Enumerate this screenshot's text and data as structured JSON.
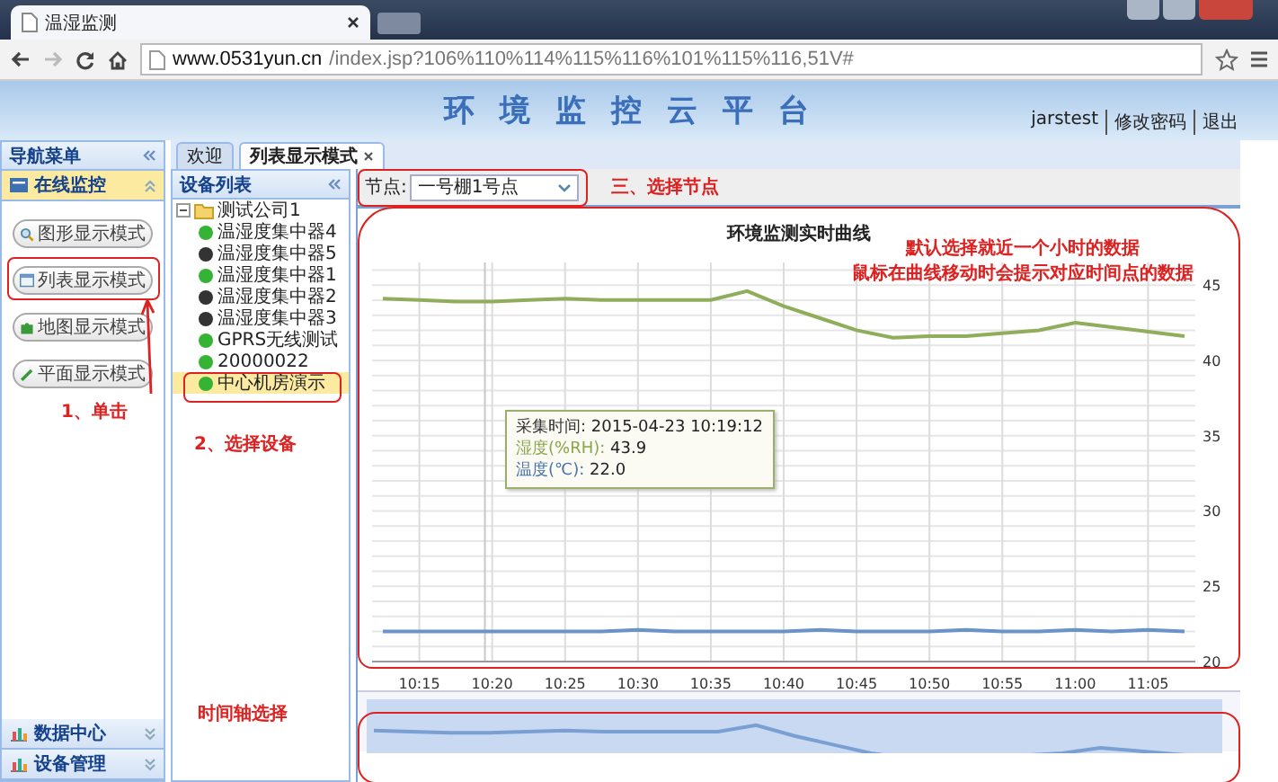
{
  "browser": {
    "tab_title": "温湿监测",
    "url_host": "www.0531yun.cn",
    "url_path": "/index.jsp?106%110%114%115%116%101%115%116,51V#"
  },
  "header": {
    "title": "环境监控云平台",
    "user": "jarstest",
    "links": [
      "修改密码",
      "退出"
    ]
  },
  "nav": {
    "title": "导航菜单",
    "sections": [
      {
        "label": "在线监控",
        "expanded": true,
        "items": [
          {
            "label": "图形显示模式"
          },
          {
            "label": "列表显示模式"
          },
          {
            "label": "地图显示模式"
          },
          {
            "label": "平面显示模式"
          }
        ]
      },
      {
        "label": "数据中心",
        "expanded": false
      },
      {
        "label": "设备管理",
        "expanded": false
      }
    ]
  },
  "tabs": [
    {
      "label": "欢迎",
      "selected": false,
      "closable": false
    },
    {
      "label": "列表显示模式",
      "selected": true,
      "closable": true
    }
  ],
  "device_list": {
    "title": "设备列表",
    "tree": [
      {
        "label": "测试公司1",
        "expanded": true,
        "children": [
          {
            "label": "温湿度集中器4",
            "online": true,
            "selected": false
          },
          {
            "label": "温湿度集中器5",
            "online": false,
            "selected": false
          },
          {
            "label": "温湿度集中器1",
            "online": true,
            "selected": false
          },
          {
            "label": "温湿度集中器2",
            "online": false,
            "selected": false
          },
          {
            "label": "温湿度集中器3",
            "online": false,
            "selected": false
          },
          {
            "label": "GPRS无线测试",
            "online": true,
            "selected": false
          },
          {
            "label": "20000022",
            "online": true,
            "selected": false
          },
          {
            "label": "中心机房演示",
            "online": true,
            "selected": true
          }
        ]
      }
    ]
  },
  "node_select": {
    "label": "节点:",
    "value": "一号棚1号点"
  },
  "chart": {
    "title": "环境监测实时曲线",
    "tooltip": {
      "lines": [
        {
          "label": "采集时间:",
          "value": "2015-04-23 10:19:12",
          "color": "#333333"
        },
        {
          "label": "湿度(%RH):",
          "value": "43.9",
          "color": "#89a54e"
        },
        {
          "label": "温度(℃):",
          "value": "22.0",
          "color": "#4572a7"
        }
      ]
    },
    "chart_data": {
      "type": "line",
      "categories": [
        null,
        "10:15",
        null,
        "10:20",
        null,
        "10:25",
        null,
        "10:30",
        null,
        "10:35",
        null,
        "10:40",
        null,
        "10:45",
        null,
        "10:50",
        null,
        "10:55",
        null,
        "11:00",
        null,
        "11:05",
        null
      ],
      "series": [
        {
          "color": "#8fad5a",
          "values": [
            44.1,
            44.0,
            43.9,
            43.9,
            44.0,
            44.1,
            44.0,
            44.0,
            44.0,
            44.0,
            44.6,
            43.6,
            42.8,
            42.0,
            41.5,
            41.6,
            41.6,
            41.8,
            42.0,
            42.5,
            42.2,
            41.9,
            41.6
          ]
        },
        {
          "color": "#6a93c9",
          "values": [
            22.0,
            22.0,
            22.0,
            22.0,
            22.0,
            22.0,
            22.0,
            22.1,
            22.0,
            22.0,
            22.0,
            22.0,
            22.1,
            22.0,
            22.0,
            22.0,
            22.1,
            22.0,
            22.0,
            22.1,
            22.0,
            22.1,
            22.0
          ]
        }
      ],
      "ylim": [
        20,
        46.5
      ],
      "grid": true,
      "yticks": [
        20,
        25,
        30,
        35,
        40,
        45
      ]
    }
  },
  "annotations": {
    "click": "1、单击",
    "device": "2、选择设备",
    "node": "三、选择节点",
    "hint_lines": [
      "默认选择就近一个小时的数据",
      "鼠标在曲线移动时会提示对应时间点的数据"
    ],
    "timeline": "时间轴选择"
  }
}
